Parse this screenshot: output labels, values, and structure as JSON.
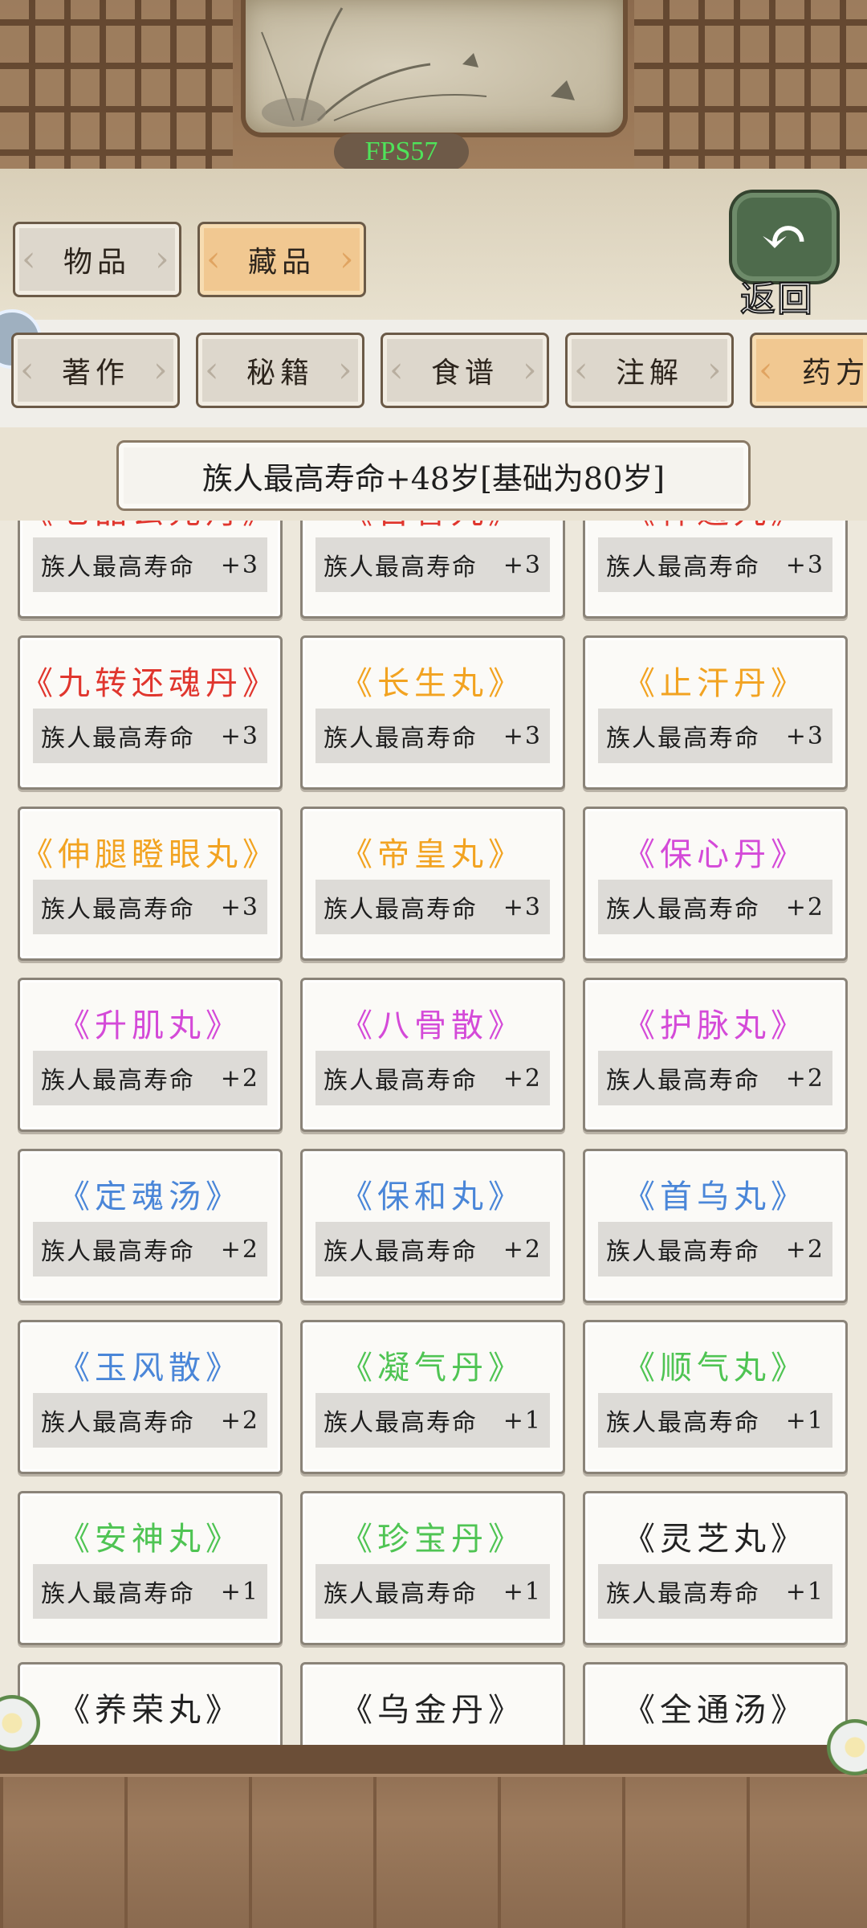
{
  "header": {
    "fps": "FPS57",
    "back_label": "返回"
  },
  "top_tabs": [
    {
      "label": "物品",
      "active": false
    },
    {
      "label": "藏品",
      "active": true
    }
  ],
  "sub_tabs": [
    {
      "label": "著作",
      "active": false
    },
    {
      "label": "秘籍",
      "active": false
    },
    {
      "label": "食谱",
      "active": false
    },
    {
      "label": "注解",
      "active": false
    },
    {
      "label": "药方",
      "active": true
    }
  ],
  "info_bar": "族人最高寿命+48岁[基础为80岁]",
  "stat_label": "族人最高寿命",
  "colors": {
    "red": "#e0362e",
    "orange": "#f2a321",
    "purple": "#d44ad8",
    "blue": "#4a86d8",
    "green": "#4fc453",
    "black": "#222222"
  },
  "items": [
    {
      "name": "《七品玄元丹》",
      "value": "+3",
      "color": "red"
    },
    {
      "name": "《百香丸》",
      "value": "+3",
      "color": "red"
    },
    {
      "name": "《神通丸》",
      "value": "+3",
      "color": "red"
    },
    {
      "name": "《九转还魂丹》",
      "value": "+3",
      "color": "red"
    },
    {
      "name": "《长生丸》",
      "value": "+3",
      "color": "orange"
    },
    {
      "name": "《止汗丹》",
      "value": "+3",
      "color": "orange"
    },
    {
      "name": "《伸腿瞪眼丸》",
      "value": "+3",
      "color": "orange"
    },
    {
      "name": "《帝皇丸》",
      "value": "+3",
      "color": "orange"
    },
    {
      "name": "《保心丹》",
      "value": "+2",
      "color": "purple"
    },
    {
      "name": "《升肌丸》",
      "value": "+2",
      "color": "purple"
    },
    {
      "name": "《八骨散》",
      "value": "+2",
      "color": "purple"
    },
    {
      "name": "《护脉丸》",
      "value": "+2",
      "color": "purple"
    },
    {
      "name": "《定魂汤》",
      "value": "+2",
      "color": "blue"
    },
    {
      "name": "《保和丸》",
      "value": "+2",
      "color": "blue"
    },
    {
      "name": "《首乌丸》",
      "value": "+2",
      "color": "blue"
    },
    {
      "name": "《玉风散》",
      "value": "+2",
      "color": "blue"
    },
    {
      "name": "《凝气丹》",
      "value": "+1",
      "color": "green"
    },
    {
      "name": "《顺气丸》",
      "value": "+1",
      "color": "green"
    },
    {
      "name": "《安神丸》",
      "value": "+1",
      "color": "green"
    },
    {
      "name": "《珍宝丹》",
      "value": "+1",
      "color": "green"
    },
    {
      "name": "《灵芝丸》",
      "value": "+1",
      "color": "black"
    },
    {
      "name": "《养荣丸》",
      "value": "",
      "color": "black"
    },
    {
      "name": "《乌金丹》",
      "value": "",
      "color": "black"
    },
    {
      "name": "《全通汤》",
      "value": "",
      "color": "black"
    }
  ]
}
